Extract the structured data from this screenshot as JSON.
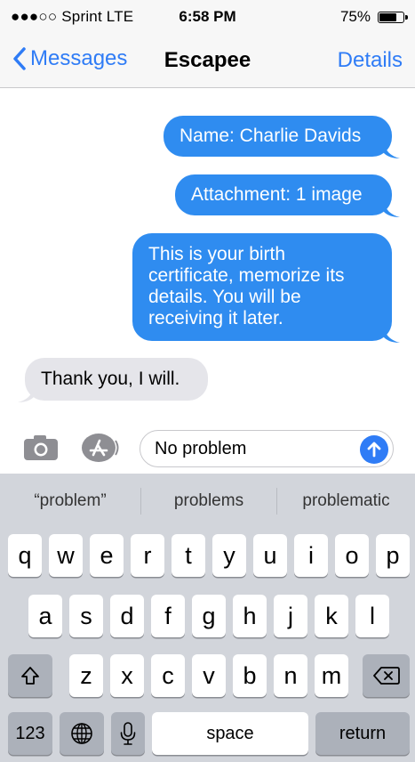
{
  "status_bar": {
    "carrier": "●●●○○ Sprint  LTE",
    "time": "6:58 PM",
    "battery": "75%",
    "battery_level": 0.75
  },
  "nav": {
    "back_label": "Messages",
    "title": "Escapee",
    "details_label": "Details"
  },
  "messages": [
    {
      "direction": "out",
      "text": "Name: Charlie Davids"
    },
    {
      "direction": "out",
      "text": "Attachment: 1 image"
    },
    {
      "direction": "out",
      "lines": [
        "This is your birth",
        "certificate, memorize its",
        "details. You will be",
        "receiving it later."
      ]
    },
    {
      "direction": "in",
      "text": "Thank you, I will."
    }
  ],
  "compose": {
    "input_value": "No problem",
    "camera_icon": "camera-icon",
    "appstore_icon": "app-store-icon",
    "send_icon": "send-arrow-icon"
  },
  "keyboard": {
    "suggestions": [
      "“problem”",
      "problems",
      "problematic"
    ],
    "row1": [
      "q",
      "w",
      "e",
      "r",
      "t",
      "y",
      "u",
      "i",
      "o",
      "p"
    ],
    "row2": [
      "a",
      "s",
      "d",
      "f",
      "g",
      "h",
      "j",
      "k",
      "l"
    ],
    "row3": [
      "z",
      "x",
      "c",
      "v",
      "b",
      "n",
      "m"
    ],
    "numbers_key": "123",
    "space_key": "space",
    "return_key": "return"
  },
  "colors": {
    "accent": "#2f7cf6",
    "outgoing_bubble": "#2f8cf0",
    "incoming_bubble": "#e5e5ea",
    "keyboard_bg": "#d2d5db"
  }
}
